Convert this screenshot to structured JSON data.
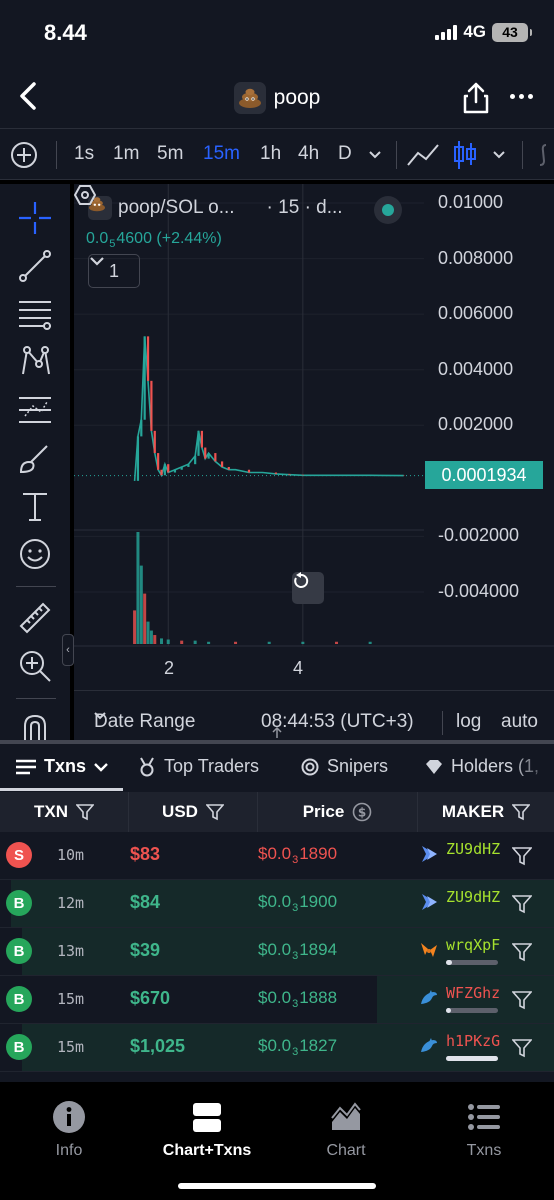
{
  "status_bar": {
    "time": "8.44",
    "network": "4G",
    "battery": "43"
  },
  "nav": {
    "title": "poop"
  },
  "timeframes": [
    "1s",
    "1m",
    "5m",
    "15m",
    "1h",
    "4h",
    "D"
  ],
  "active_timeframe": "15m",
  "chart": {
    "legend_title": "poop/SOL o...",
    "legend_interval": "· 15 · d...",
    "price_prefix": "0.0",
    "price_zeros": "5",
    "price_suffix": "4600 (+2.44%)",
    "indicator_count": "1",
    "current_price": "0.0001934",
    "y_ticks": [
      "0.01000",
      "0.008000",
      "0.006000",
      "0.004000",
      "0.002000",
      "-0.002000",
      "-0.004000"
    ],
    "x_ticks": [
      "2",
      "4"
    ],
    "date_range_label": "Date Range",
    "clock": "08:44:53 (UTC+3)",
    "scale_log": "log",
    "scale_auto": "auto"
  },
  "chart_data": {
    "type": "line",
    "y_ticks": [
      0.01,
      0.008,
      0.006,
      0.004,
      0.002,
      -0.002,
      -0.004
    ],
    "ylim": [
      -0.004,
      0.01
    ],
    "x_ticks": [
      2,
      4
    ],
    "xlim": [
      0.6,
      5.8
    ],
    "grid": true,
    "series": [
      {
        "x": [
          1.5,
          1.55,
          1.6,
          1.65,
          1.7,
          1.75,
          1.8,
          1.85,
          1.9,
          1.95,
          2.0,
          2.1,
          2.2,
          2.3,
          2.4,
          2.45,
          2.5,
          2.55,
          2.6,
          2.7,
          2.8,
          2.9,
          3.0,
          3.2,
          3.4,
          3.6,
          3.8,
          4.0,
          4.5,
          5.0,
          5.5
        ],
        "y": [
          0.0,
          0.0016,
          0.0022,
          0.0052,
          0.0036,
          0.0018,
          0.001,
          0.0004,
          0.0002,
          0.0006,
          0.0003,
          0.0004,
          0.0005,
          0.0006,
          0.0009,
          0.0018,
          0.0012,
          0.0008,
          0.001,
          0.0007,
          0.0005,
          0.0004,
          0.0004,
          0.0003,
          0.0003,
          0.00025,
          0.00022,
          0.0002,
          0.0002,
          0.0002,
          0.00019
        ]
      }
    ],
    "volume": {
      "x": [
        1.5,
        1.55,
        1.6,
        1.65,
        1.7,
        1.75,
        1.8,
        1.9,
        2.0,
        2.2,
        2.4,
        2.6,
        3.0,
        3.5,
        4.0,
        4.5,
        5.0
      ],
      "v": [
        0.3,
        1.0,
        0.7,
        0.45,
        0.2,
        0.12,
        0.08,
        0.05,
        0.04,
        0.03,
        0.03,
        0.02,
        0.02,
        0.02,
        0.02,
        0.02,
        0.02
      ]
    }
  },
  "txn_tabs": [
    {
      "label": "Txns",
      "icon": "list-icon"
    },
    {
      "label": "Top Traders",
      "icon": "medal-icon"
    },
    {
      "label": "Snipers",
      "icon": "target-icon"
    },
    {
      "label": "Holders (1,",
      "icon": "diamond-icon"
    }
  ],
  "table": {
    "headers": {
      "txn": "TXN",
      "usd": "USD",
      "price": "Price",
      "maker": "MAKER"
    },
    "rows": [
      {
        "side": "S",
        "age": "10m",
        "usd": "$83",
        "price_prefix": "$0.0",
        "price_zeros": "3",
        "price_suffix": "1890",
        "maker": "ZU9dHZ",
        "maker_color": "#a6e22e",
        "icon": "solana-icon",
        "bar": 0,
        "bg_frac": 0.0
      },
      {
        "side": "B",
        "age": "12m",
        "usd": "$84",
        "price_prefix": "$0.0",
        "price_zeros": "3",
        "price_suffix": "1900",
        "maker": "ZU9dHZ",
        "maker_color": "#a6e22e",
        "icon": "solana-icon",
        "bar": 0,
        "bg_frac": 0.98
      },
      {
        "side": "B",
        "age": "13m",
        "usd": "$39",
        "price_prefix": "$0.0",
        "price_zeros": "3",
        "price_suffix": "1894",
        "maker": "wrqXpF",
        "maker_color": "#a6e22e",
        "icon": "fox-icon",
        "bar": 0.12,
        "bg_frac": 0.96
      },
      {
        "side": "B",
        "age": "15m",
        "usd": "$670",
        "price_prefix": "$0.0",
        "price_zeros": "3",
        "price_suffix": "1888",
        "maker": "WFZGhz",
        "maker_color": "#ef5350",
        "icon": "dolphin-icon",
        "bar": 0.1,
        "bg_frac": 0.32
      },
      {
        "side": "B",
        "age": "15m",
        "usd": "$1,025",
        "price_prefix": "$0.0",
        "price_zeros": "3",
        "price_suffix": "1827",
        "maker": "h1PKzG",
        "maker_color": "#ef5350",
        "icon": "dolphin-icon",
        "bar": 1.0,
        "bg_frac": 0.96
      }
    ]
  },
  "bottom_tabs": [
    {
      "label": "Info",
      "icon": "info-icon"
    },
    {
      "label": "Chart+Txns",
      "icon": "split-view-icon"
    },
    {
      "label": "Chart",
      "icon": "area-chart-icon"
    },
    {
      "label": "Txns",
      "icon": "list-icon"
    }
  ],
  "active_bottom_tab": "Chart+Txns",
  "colors": {
    "background": "#131722",
    "accent": "#2962ff",
    "up": "#26a69a",
    "down": "#ef5350",
    "buy_badge": "#26a65b"
  }
}
